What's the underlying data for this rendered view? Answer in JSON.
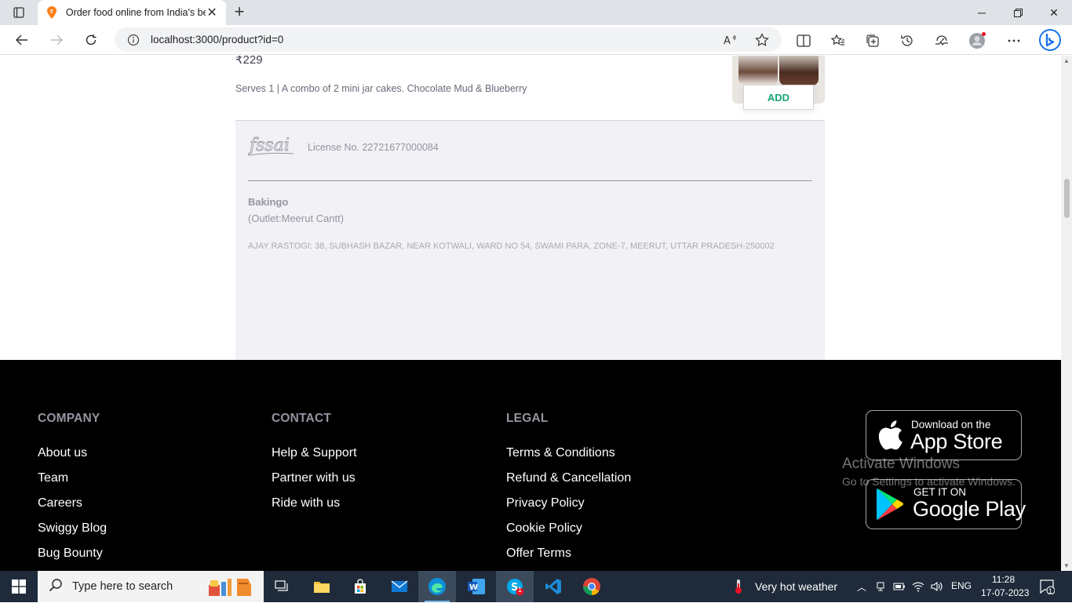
{
  "browser": {
    "tab_title": "Order food online from India's best",
    "url": "localhost:3000/product?id=0",
    "new_tab_label": "+"
  },
  "product": {
    "price": "₹229",
    "description": "Serves 1 | A combo of 2 mini jar cakes. Chocolate Mud & Blueberry",
    "add_label": "ADD"
  },
  "license": {
    "logo_text": "fssai",
    "number": "License No. 22721677000084",
    "brand": "Bakingo",
    "outlet": "(Outlet:Meerut Cantt)",
    "address": "AJAY RASTOGI: 38, SUBHASH BAZAR, NEAR KOTWALI, WARD NO 54, SWAMI PARA, ZONE-7, MEERUT, UTTAR PRADESH-250002"
  },
  "footer": {
    "company": {
      "heading": "COMPANY",
      "links": [
        "About us",
        "Team",
        "Careers",
        "Swiggy Blog",
        "Bug Bounty"
      ]
    },
    "contact": {
      "heading": "CONTACT",
      "links": [
        "Help & Support",
        "Partner with us",
        "Ride with us"
      ]
    },
    "legal": {
      "heading": "LEGAL",
      "links": [
        "Terms & Conditions",
        "Refund & Cancellation",
        "Privacy Policy",
        "Cookie Policy",
        "Offer Terms"
      ]
    },
    "app_store": {
      "small": "Download on the",
      "big": "App Store"
    },
    "google_play": {
      "small": "GET IT ON",
      "big": "Google Play"
    }
  },
  "watermark": {
    "line1": "Activate Windows",
    "line2": "Go to Settings to activate Windows."
  },
  "taskbar": {
    "search_placeholder": "Type here to search",
    "weather": "Very hot weather",
    "language": "ENG",
    "time": "11:28",
    "date": "17-07-2023",
    "notification_count": "1",
    "skype_badge": "1"
  },
  "colors": {
    "add_green": "#1ba672",
    "footer_bg": "#000000",
    "license_bg": "#f1f1f6",
    "taskbar_bg": "#1f2b3a"
  }
}
